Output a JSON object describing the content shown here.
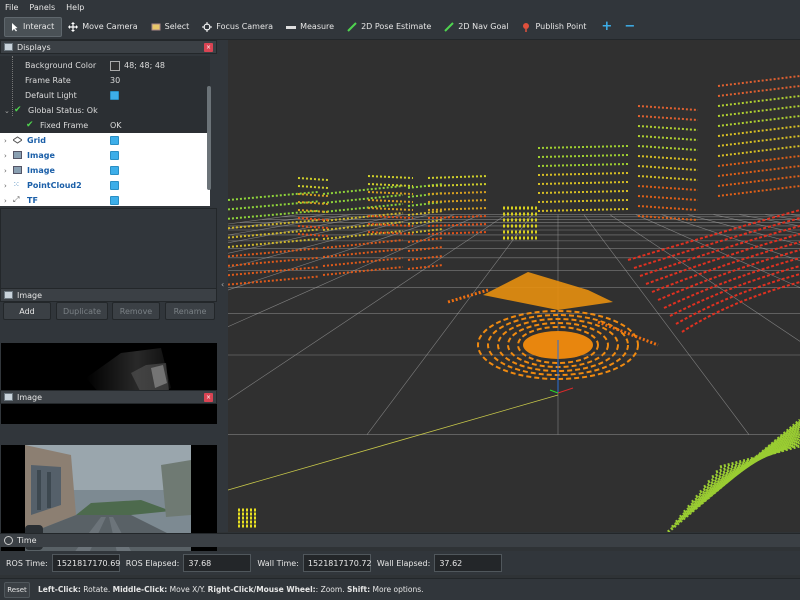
{
  "menu": [
    "File",
    "Panels",
    "Help"
  ],
  "toolbar": {
    "tools": [
      {
        "label": "Interact",
        "icon": "cursor-icon",
        "active": true
      },
      {
        "label": "Move Camera",
        "icon": "move-icon"
      },
      {
        "label": "Select",
        "icon": "select-icon"
      },
      {
        "label": "Focus Camera",
        "icon": "focus-icon"
      },
      {
        "label": "Measure",
        "icon": "ruler-icon"
      },
      {
        "label": "2D Pose Estimate",
        "icon": "green-arrow-icon"
      },
      {
        "label": "2D Nav Goal",
        "icon": "green-arrow-icon"
      },
      {
        "label": "Publish Point",
        "icon": "pin-icon"
      }
    ],
    "add_symbol": "+",
    "remove_symbol": "−"
  },
  "displays": {
    "title": "Displays",
    "close": "×",
    "rows": [
      {
        "name": "Background Color",
        "value": "48; 48; 48"
      },
      {
        "name": "Frame Rate",
        "value": "30"
      },
      {
        "name": "Default Light",
        "value": ""
      },
      {
        "name": "Global Status: Ok",
        "value": ""
      },
      {
        "name": "Fixed Frame",
        "value": "OK"
      },
      {
        "name": "Grid",
        "value": ""
      },
      {
        "name": "Image",
        "value": ""
      },
      {
        "name": "Image",
        "value": ""
      },
      {
        "name": "PointCloud2",
        "value": ""
      },
      {
        "name": "TF",
        "value": ""
      }
    ],
    "buttons": {
      "add": "Add",
      "duplicate": "Duplicate",
      "remove": "Remove",
      "rename": "Rename"
    }
  },
  "image_panel_1": {
    "title": "Image",
    "close": "×"
  },
  "image_panel_2": {
    "title": "Image",
    "close": "×"
  },
  "time": {
    "title": "Time",
    "ros_time_label": "ROS Time:",
    "ros_time": "1521817170.69",
    "ros_elapsed_label": "ROS Elapsed:",
    "ros_elapsed": "37.68",
    "wall_time_label": "Wall Time:",
    "wall_time": "1521817170.72",
    "wall_elapsed_label": "Wall Elapsed:",
    "wall_elapsed": "37.62"
  },
  "status": {
    "reset": "Reset",
    "k1": "Left-Click:",
    "v1": " Rotate. ",
    "k2": "Middle-Click:",
    "v2": " Move X/Y. ",
    "k3": "Right-Click/Mouse Wheel:",
    "v3": ": Zoom. ",
    "k4": "Shift:",
    "v4": " More options."
  },
  "colors": {
    "accent": "#3daee9",
    "close": "#da4453",
    "background": "#303030"
  }
}
